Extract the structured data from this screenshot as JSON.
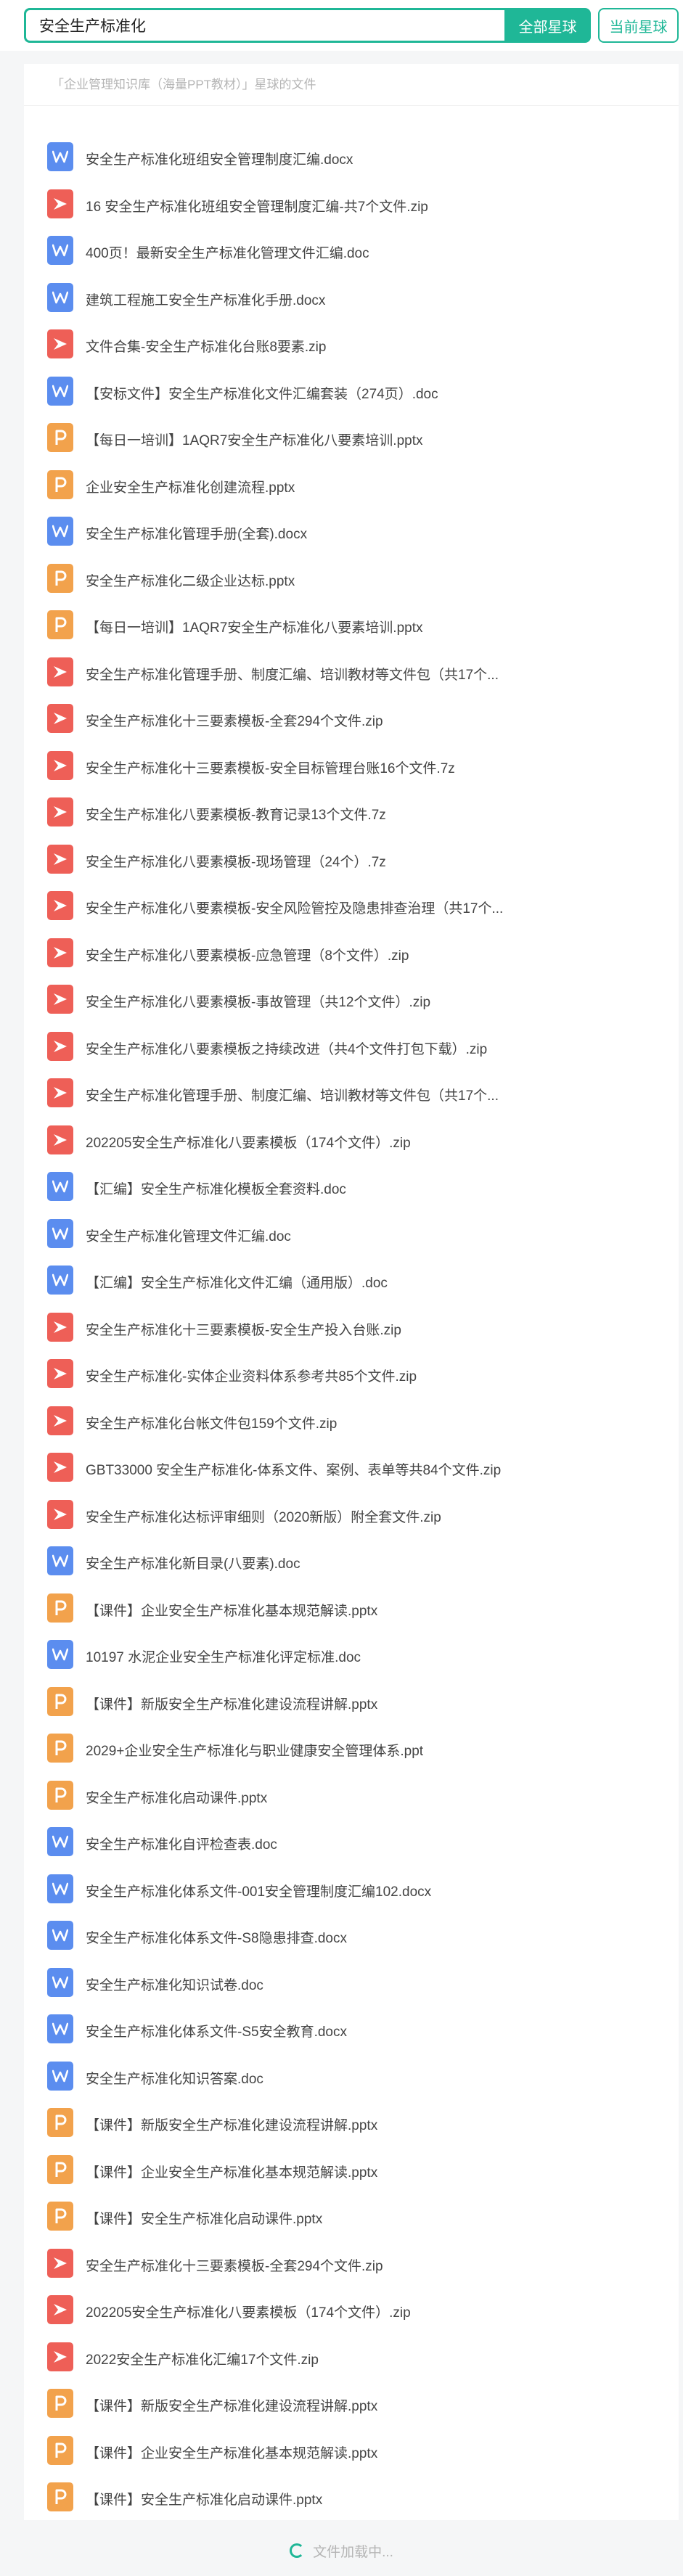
{
  "search": {
    "value": "安全生产标准化",
    "all_button": "全部星球",
    "current_button": "当前星球"
  },
  "scope_label": "「企业管理知识库（海量PPT教材）」星球的文件",
  "files": [
    {
      "name": "安全生产标准化班组安全管理制度汇编.docx",
      "icon": "word-icon"
    },
    {
      "name": "16 安全生产标准化班组安全管理制度汇编-共7个文件.zip",
      "icon": "zip-icon"
    },
    {
      "name": "400页！最新安全生产标准化管理文件汇编.doc",
      "icon": "word-icon"
    },
    {
      "name": "建筑工程施工安全生产标准化手册.docx",
      "icon": "word-icon"
    },
    {
      "name": "文件合集-安全生产标准化台账8要素.zip",
      "icon": "zip-icon"
    },
    {
      "name": "【安标文件】安全生产标准化文件汇编套装（274页）.doc",
      "icon": "word-icon"
    },
    {
      "name": "【每日一培训】1AQR7安全生产标准化八要素培训.pptx",
      "icon": "ppt-icon"
    },
    {
      "name": "企业安全生产标准化创建流程.pptx",
      "icon": "ppt-icon"
    },
    {
      "name": "安全生产标准化管理手册(全套).docx",
      "icon": "word-icon"
    },
    {
      "name": "安全生产标准化二级企业达标.pptx",
      "icon": "ppt-icon"
    },
    {
      "name": "【每日一培训】1AQR7安全生产标准化八要素培训.pptx",
      "icon": "ppt-icon"
    },
    {
      "name": "安全生产标准化管理手册、制度汇编、培训教材等文件包（共17个...",
      "icon": "zip-icon"
    },
    {
      "name": "安全生产标准化十三要素模板-全套294个文件.zip",
      "icon": "zip-icon"
    },
    {
      "name": "安全生产标准化十三要素模板-安全目标管理台账16个文件.7z",
      "icon": "zip-icon"
    },
    {
      "name": "安全生产标准化八要素模板-教育记录13个文件.7z",
      "icon": "zip-icon"
    },
    {
      "name": "安全生产标准化八要素模板-现场管理（24个）.7z",
      "icon": "zip-icon"
    },
    {
      "name": "安全生产标准化八要素模板-安全风险管控及隐患排查治理（共17个...",
      "icon": "zip-icon"
    },
    {
      "name": "安全生产标准化八要素模板-应急管理（8个文件）.zip",
      "icon": "zip-icon"
    },
    {
      "name": "安全生产标准化八要素模板-事故管理（共12个文件）.zip",
      "icon": "zip-icon"
    },
    {
      "name": "安全生产标准化八要素模板之持续改进（共4个文件打包下载）.zip",
      "icon": "zip-icon"
    },
    {
      "name": "安全生产标准化管理手册、制度汇编、培训教材等文件包（共17个...",
      "icon": "zip-icon"
    },
    {
      "name": "202205安全生产标准化八要素模板（174个文件）.zip",
      "icon": "zip-icon"
    },
    {
      "name": "【汇编】安全生产标准化模板全套资料.doc",
      "icon": "word-icon"
    },
    {
      "name": "安全生产标准化管理文件汇编.doc",
      "icon": "word-icon"
    },
    {
      "name": "【汇编】安全生产标准化文件汇编（通用版）.doc",
      "icon": "word-icon"
    },
    {
      "name": "安全生产标准化十三要素模板-安全生产投入台账.zip",
      "icon": "zip-icon"
    },
    {
      "name": "安全生产标准化-实体企业资料体系参考共85个文件.zip",
      "icon": "zip-icon"
    },
    {
      "name": "安全生产标准化台帐文件包159个文件.zip",
      "icon": "zip-icon"
    },
    {
      "name": "GBT33000 安全生产标准化-体系文件、案例、表单等共84个文件.zip",
      "icon": "zip-icon"
    },
    {
      "name": "安全生产标准化达标评审细则（2020新版）附全套文件.zip",
      "icon": "zip-icon"
    },
    {
      "name": "安全生产标准化新目录(八要素).doc",
      "icon": "word-icon"
    },
    {
      "name": "【课件】企业安全生产标准化基本规范解读.pptx",
      "icon": "ppt-icon"
    },
    {
      "name": "10197 水泥企业安全生产标准化评定标准.doc",
      "icon": "word-icon"
    },
    {
      "name": "【课件】新版安全生产标准化建设流程讲解.pptx",
      "icon": "ppt-icon"
    },
    {
      "name": "2029+企业安全生产标准化与职业健康安全管理体系.ppt",
      "icon": "ppt-icon"
    },
    {
      "name": "安全生产标准化启动课件.pptx",
      "icon": "ppt-icon"
    },
    {
      "name": "安全生产标准化自评检查表.doc",
      "icon": "word-icon"
    },
    {
      "name": "安全生产标准化体系文件-001安全管理制度汇编102.docx",
      "icon": "word-icon"
    },
    {
      "name": "安全生产标准化体系文件-S8隐患排查.docx",
      "icon": "word-icon"
    },
    {
      "name": "安全生产标准化知识试卷.doc",
      "icon": "word-icon"
    },
    {
      "name": "安全生产标准化体系文件-S5安全教育.docx",
      "icon": "word-icon"
    },
    {
      "name": "安全生产标准化知识答案.doc",
      "icon": "word-icon"
    },
    {
      "name": "【课件】新版安全生产标准化建设流程讲解.pptx",
      "icon": "ppt-icon"
    },
    {
      "name": "【课件】企业安全生产标准化基本规范解读.pptx",
      "icon": "ppt-icon"
    },
    {
      "name": "【课件】安全生产标准化启动课件.pptx",
      "icon": "ppt-icon"
    },
    {
      "name": "安全生产标准化十三要素模板-全套294个文件.zip",
      "icon": "zip-icon"
    },
    {
      "name": "202205安全生产标准化八要素模板（174个文件）.zip",
      "icon": "zip-icon"
    },
    {
      "name": "2022安全生产标准化汇编17个文件.zip",
      "icon": "zip-icon"
    },
    {
      "name": "【课件】新版安全生产标准化建设流程讲解.pptx",
      "icon": "ppt-icon"
    },
    {
      "name": "【课件】企业安全生产标准化基本规范解读.pptx",
      "icon": "ppt-icon"
    },
    {
      "name": "【课件】安全生产标准化启动课件.pptx",
      "icon": "ppt-icon"
    }
  ],
  "loading_text": "文件加载中...",
  "colors": {
    "accent": "#1fb797",
    "word": "#5b8def",
    "ppt": "#f2a24c",
    "zip": "#ee5f57"
  }
}
